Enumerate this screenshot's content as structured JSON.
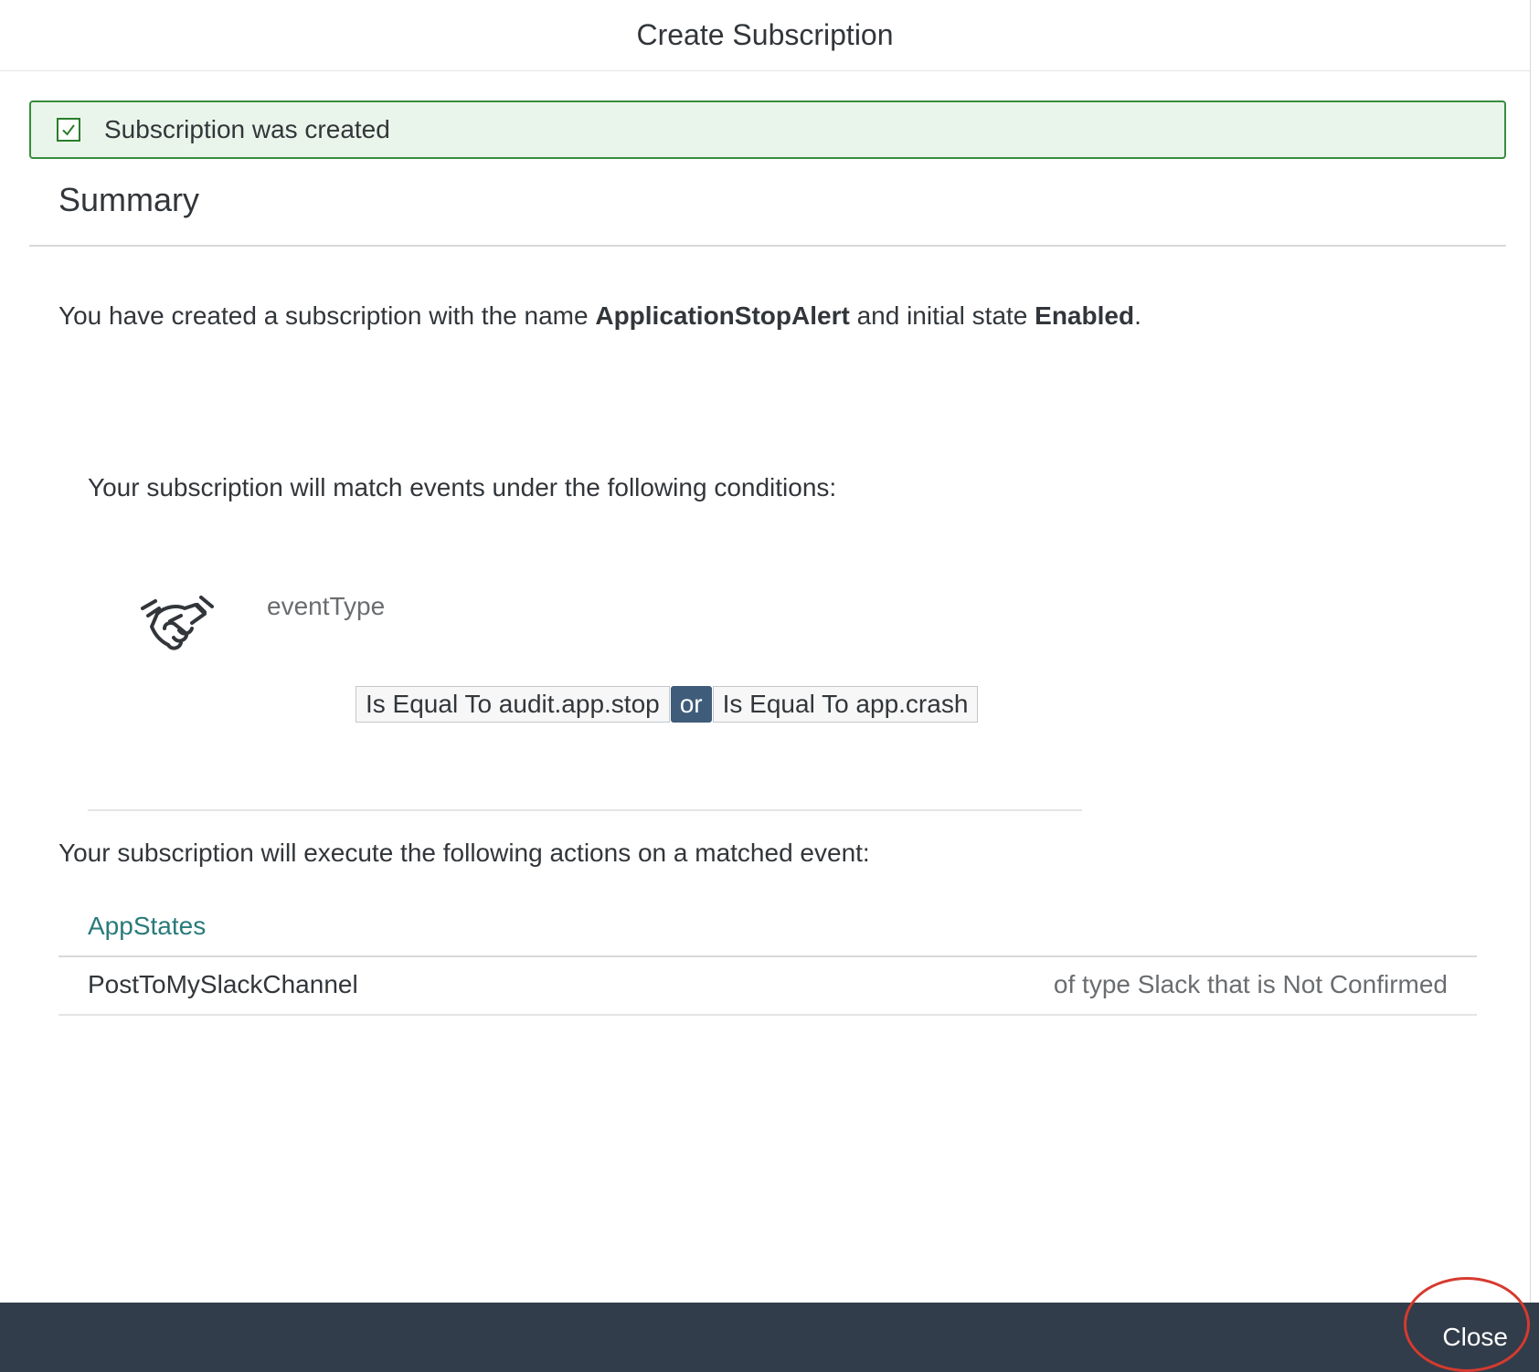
{
  "dialog": {
    "title": "Create Subscription"
  },
  "message": {
    "text": "Subscription was created",
    "icon": "checkbox-check-icon"
  },
  "summary": {
    "heading": "Summary",
    "sentence_prefix": "You have created a subscription with the name ",
    "subscription_name": "ApplicationStopAlert",
    "sentence_middle": " and initial state ",
    "initial_state": "Enabled",
    "sentence_suffix": "."
  },
  "conditions": {
    "intro": "Your subscription will match events under the following conditions:",
    "icon": "handshake-icon",
    "field": "eventType",
    "values": [
      "Is Equal To audit.app.stop",
      "Is Equal To app.crash"
    ],
    "operator": "or"
  },
  "actions": {
    "intro": "Your subscription will execute the following actions on a matched event:",
    "group_label": "AppStates",
    "items": [
      {
        "name": "PostToMySlackChannel",
        "description": "of type Slack that is Not Confirmed"
      }
    ]
  },
  "footer": {
    "close_label": "Close"
  },
  "colors": {
    "success_border": "#3a8c3f",
    "success_background": "#e9f5ea",
    "footer_background": "#313d4a",
    "operator_background": "#3f5c7a",
    "link_color": "#2a7a7a",
    "highlight_ring": "#d63a2f"
  }
}
